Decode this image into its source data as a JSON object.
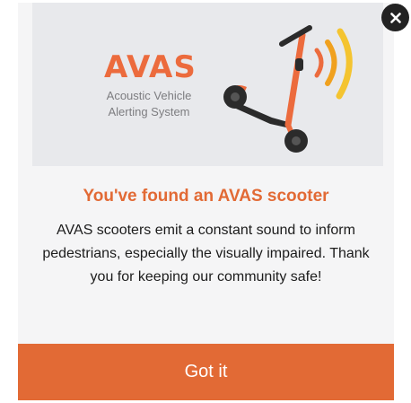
{
  "hero": {
    "brand_title": "AVAS",
    "brand_subtitle_line1": "Acoustic Vehicle",
    "brand_subtitle_line2": "Alerting System"
  },
  "dialog": {
    "heading": "You've found an AVAS scooter",
    "body": "AVAS scooters emit a constant sound to inform pedestrians, especially the visually impaired. Thank you for keeping our community safe!",
    "button_label": "Got it"
  },
  "icons": {
    "close": "close-icon",
    "scooter": "scooter-illustration",
    "sound_waves": "sound-waves-icon"
  },
  "colors": {
    "accent": "#E26A35",
    "brand_orange": "#EC6B3D",
    "sound_yellow": "#F4C430",
    "close_bg": "#222222",
    "panel_bg": "#F5F5F6",
    "hero_bg": "#E8E9EC"
  }
}
